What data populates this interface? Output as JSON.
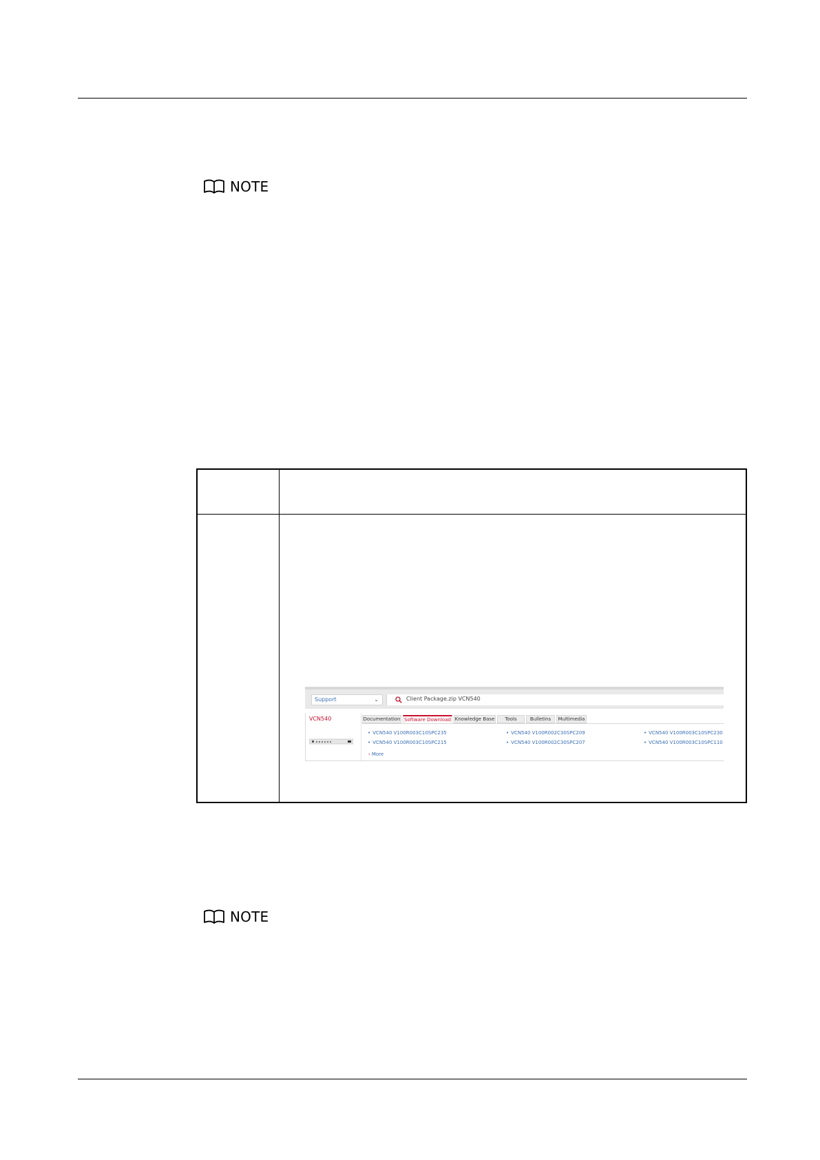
{
  "notes": [
    {
      "label": "NOTE"
    },
    {
      "label": "NOTE"
    }
  ],
  "screenshot": {
    "support_select": "Support",
    "search_query": "Client Package.zip VCN540",
    "product_name": "VCN540",
    "tabs": [
      "Documentation",
      "Software Download",
      "Knowledge Base",
      "Tools",
      "Bulletins",
      "Multimedia"
    ],
    "active_tab": "Software Download",
    "links": [
      "VCN540 V100R003C10SPC235",
      "VCN540 V100R002C30SPC209",
      "VCN540 V100R003C10SPC230",
      "VCN540 V100R003C10SPC215",
      "VCN540 V100R002C30SPC207",
      "VCN540 V100R003C10SPC110"
    ],
    "more_label": "More"
  }
}
